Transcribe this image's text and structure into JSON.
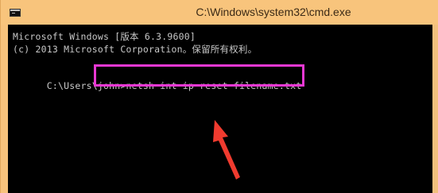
{
  "window": {
    "title": "C:\\Windows\\system32\\cmd.exe",
    "app_icon": "console-icon"
  },
  "console": {
    "line1": "Microsoft Windows [版本 6.3.9600]",
    "line2": "(c) 2013 Microsoft Corporation。保留所有权利。",
    "prompt": "C:\\Users\\john>",
    "command": "netsh int ip reset filename.txt"
  },
  "annotation": {
    "highlight_color": "#e938d3",
    "arrow_color": "#f03b2f"
  }
}
